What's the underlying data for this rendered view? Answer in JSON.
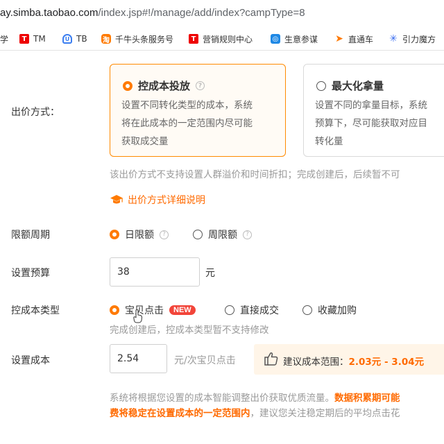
{
  "address_bar": {
    "url_host": "ay.simba.taobao.com",
    "url_path": "/index.jsp#!/manage/add/index?campType=8"
  },
  "bookmarks": [
    {
      "label": "学",
      "icon": "none"
    },
    {
      "label": "TM",
      "icon": "tmall-icon"
    },
    {
      "label": "TB",
      "icon": "taobao-icon"
    },
    {
      "label": "千牛头条服务号",
      "icon": "qianniu-icon"
    },
    {
      "label": "营销规则中心",
      "icon": "tmall-icon"
    },
    {
      "label": "生意参谋",
      "icon": "shengyi-icon"
    },
    {
      "label": "直通车",
      "icon": "ztc-icon"
    },
    {
      "label": "引力魔方",
      "icon": "yinli-icon"
    }
  ],
  "bid_method": {
    "label": "出价方式：",
    "options": [
      {
        "title": "控成本投放",
        "desc": [
          "设置不同转化类型的成本，系统",
          "将在此成本的一定范围内尽可能",
          "获取成交量"
        ],
        "selected": true
      },
      {
        "title": "最大化拿量",
        "desc": [
          "设置不同的拿量目标，系统",
          "预算下，尽可能获取对应目",
          "转化量"
        ],
        "selected": false
      }
    ],
    "note": "该出价方式不支持设置人群溢价和时间折扣；完成创建后，后续暂不可",
    "detail_link": "出价方式详细说明"
  },
  "limit_period": {
    "label": "限额周期",
    "options": [
      {
        "label": "日限额",
        "selected": true
      },
      {
        "label": "周限额",
        "selected": false
      }
    ]
  },
  "budget": {
    "label": "设置预算",
    "value": "38",
    "unit": "元"
  },
  "cost_type": {
    "label": "控成本类型",
    "options": [
      {
        "label": "宝贝点击",
        "selected": true,
        "badge": "NEW"
      },
      {
        "label": "直接成交",
        "selected": false
      },
      {
        "label": "收藏加购",
        "selected": false
      }
    ],
    "note": "完成创建后，控成本类型暂不支持修改"
  },
  "cost": {
    "label": "设置成本",
    "value": "2.54",
    "unit": "元/次宝贝点击",
    "suggest_prefix": "建议成本范围：",
    "suggest_range": "2.03元 - 3.04元"
  },
  "footer_note": {
    "line1_gray": "系统将根据您设置的成本智能调整出价获取优质流量。",
    "line1_orange": "数据积累期可能",
    "line2_orange": "费将稳定在设置成本的一定范围内",
    "line2_gray": "，建议您关注稳定期后的平均点击花"
  },
  "colors": {
    "accent": "#ff7a00",
    "badge": "#f2453a",
    "tip_bg": "#fff5e8"
  }
}
